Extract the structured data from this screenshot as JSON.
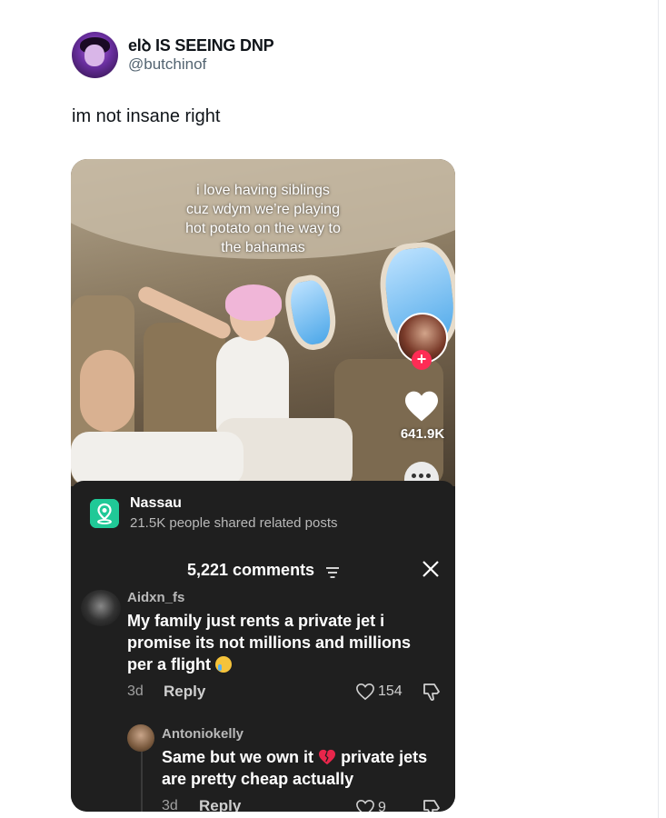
{
  "tweet": {
    "display_name": "elꝺ IS SEEING DNP",
    "handle": "@butchinof",
    "text": "im not insane right"
  },
  "video": {
    "caption_lines": [
      "i love having siblings",
      "cuz wdym we’re playing",
      "hot potato on the way to",
      "the bahamas"
    ],
    "like_count": "641.9K",
    "follow_symbol": "+"
  },
  "location": {
    "name": "Nassau",
    "subtitle": "21.5K people shared related posts"
  },
  "comments": {
    "title": "5,221 comments",
    "items": [
      {
        "username": "Aidxn_fs",
        "text": "My family just rents a private jet i promise its not millions and millions per a flight",
        "time": "3d",
        "reply_label": "Reply",
        "likes": "154"
      },
      {
        "username": "Antoniokelly",
        "text_before": "Same but we own it",
        "text_after": "private jets are pretty cheap actually",
        "time": "3d",
        "reply_label": "Reply",
        "likes": "9"
      }
    ]
  },
  "colors": {
    "accent_red": "#fe2c55",
    "panel_bg": "#1f1f1f",
    "location_icon": "#20c997"
  }
}
